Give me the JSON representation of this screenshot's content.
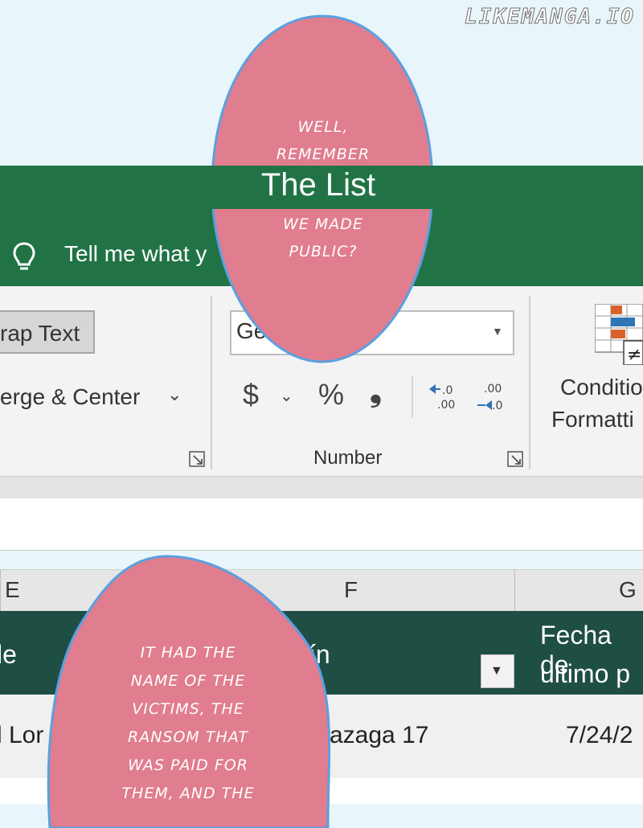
{
  "watermark": "LIKEMANGA.IO",
  "title": "The List",
  "tell_me": "Tell me what y",
  "ribbon": {
    "wrap_text": "rap Text",
    "merge_center": "erge & Center",
    "merge_chevron": "⌄",
    "number_format_value": "Ge",
    "dropdown_arrow": "▼",
    "currency_symbol": "$",
    "currency_chevron": "⌄",
    "percent_symbol": "%",
    "comma_symbol": "❟",
    "increase_decimal_icon": "increase-decimal-icon",
    "decrease_decimal_icon": "decrease-decimal-icon",
    "number_group_label": "Number",
    "conditional_formatting_line1": "Conditio",
    "conditional_formatting_line2": "Formatti"
  },
  "columns": [
    "E",
    "F",
    "G"
  ],
  "table_header": {
    "col_e": "le",
    "col_f": "ín",
    "col_g_line1": "Fecha de",
    "col_g_line2": "ultimo p",
    "filter_arrow": "▼"
  },
  "row1": {
    "col_e": "l Lor",
    "col_f": "azaga 17",
    "col_g": "7/24/2"
  },
  "speech_top": [
    "well,",
    "remember",
    "we made",
    "public?"
  ],
  "speech_bottom": [
    "it had the",
    "name of the",
    "victims, the",
    "ransom that",
    "was paid for",
    "them, and the"
  ],
  "colors": {
    "excel_green": "#217346",
    "table_header_green": "#1f4e45",
    "bubble_pink": "#e07d8e",
    "bubble_outline": "#5aa0e0",
    "sky": "#e8f6fb"
  }
}
